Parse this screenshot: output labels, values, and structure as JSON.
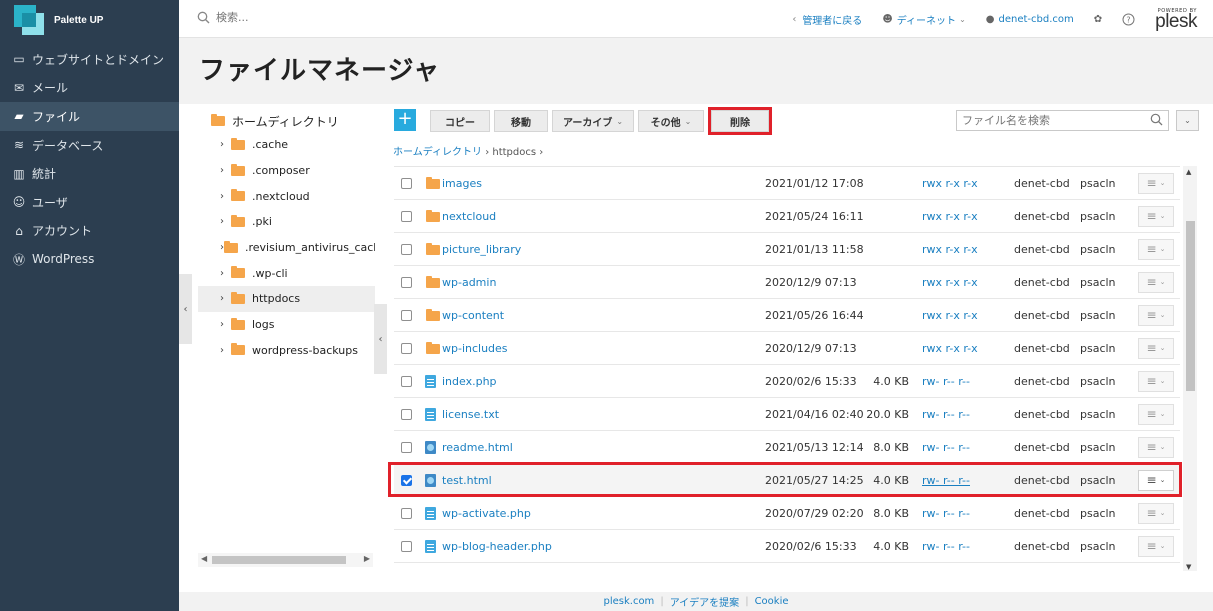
{
  "app": {
    "brand": "Palette UP"
  },
  "nav": {
    "items": [
      {
        "label": "ウェブサイトとドメイン",
        "icon": "monitor-icon"
      },
      {
        "label": "メール",
        "icon": "mail-icon"
      },
      {
        "label": "ファイル",
        "icon": "folder-icon",
        "active": true
      },
      {
        "label": "データベース",
        "icon": "database-icon"
      },
      {
        "label": "統計",
        "icon": "stats-icon"
      },
      {
        "label": "ユーザ",
        "icon": "user-icon"
      },
      {
        "label": "アカウント",
        "icon": "account-icon"
      },
      {
        "label": "WordPress",
        "icon": "wordpress-icon"
      }
    ]
  },
  "topbar": {
    "search_placeholder": "検索...",
    "back_admin": "管理者に戻る",
    "user": "ディーネット",
    "domain": "denet-cbd.com",
    "powered_by": "POWERED BY",
    "plesk": "plesk"
  },
  "page": {
    "title": "ファイルマネージャ"
  },
  "tree": {
    "root": "ホームディレクトリ",
    "items": [
      {
        "label": ".cache"
      },
      {
        "label": ".composer"
      },
      {
        "label": ".nextcloud"
      },
      {
        "label": ".pki"
      },
      {
        "label": ".revisium_antivirus_cache"
      },
      {
        "label": ".wp-cli"
      },
      {
        "label": "httpdocs",
        "selected": true
      },
      {
        "label": "logs"
      },
      {
        "label": "wordpress-backups"
      }
    ]
  },
  "toolbar": {
    "add": "+",
    "copy": "コピー",
    "move": "移動",
    "archive": "アーカイブ",
    "other": "その他",
    "delete": "削除",
    "search_placeholder": "ファイル名を検索"
  },
  "breadcrumb": {
    "root": "ホームディレクトリ",
    "current": "httpdocs"
  },
  "files": [
    {
      "name": "images",
      "type": "folder",
      "date": "2021/01/12 17:08",
      "size": "",
      "perm": "rwx r-x r-x",
      "user": "denet-cbd",
      "group": "psacln",
      "checked": false
    },
    {
      "name": "nextcloud",
      "type": "folder",
      "date": "2021/05/24 16:11",
      "size": "",
      "perm": "rwx r-x r-x",
      "user": "denet-cbd",
      "group": "psacln",
      "checked": false
    },
    {
      "name": "picture_library",
      "type": "folder",
      "date": "2021/01/13 11:58",
      "size": "",
      "perm": "rwx r-x r-x",
      "user": "denet-cbd",
      "group": "psacln",
      "checked": false
    },
    {
      "name": "wp-admin",
      "type": "folder",
      "date": "2020/12/9 07:13",
      "size": "",
      "perm": "rwx r-x r-x",
      "user": "denet-cbd",
      "group": "psacln",
      "checked": false
    },
    {
      "name": "wp-content",
      "type": "folder",
      "date": "2021/05/26 16:44",
      "size": "",
      "perm": "rwx r-x r-x",
      "user": "denet-cbd",
      "group": "psacln",
      "checked": false
    },
    {
      "name": "wp-includes",
      "type": "folder",
      "date": "2020/12/9 07:13",
      "size": "",
      "perm": "rwx r-x r-x",
      "user": "denet-cbd",
      "group": "psacln",
      "checked": false
    },
    {
      "name": "index.php",
      "type": "doc",
      "date": "2020/02/6 15:33",
      "size": "4.0 KB",
      "perm": "rw- r-- r--",
      "user": "denet-cbd",
      "group": "psacln",
      "checked": false
    },
    {
      "name": "license.txt",
      "type": "doc",
      "date": "2021/04/16 02:40",
      "size": "20.0 KB",
      "perm": "rw- r-- r--",
      "user": "denet-cbd",
      "group": "psacln",
      "checked": false
    },
    {
      "name": "readme.html",
      "type": "html",
      "date": "2021/05/13 12:14",
      "size": "8.0 KB",
      "perm": "rw- r-- r--",
      "user": "denet-cbd",
      "group": "psacln",
      "checked": false
    },
    {
      "name": "test.html",
      "type": "html",
      "date": "2021/05/27 14:25",
      "size": "4.0 KB",
      "perm": "rw- r-- r--",
      "user": "denet-cbd",
      "group": "psacln",
      "checked": true
    },
    {
      "name": "wp-activate.php",
      "type": "doc",
      "date": "2020/07/29 02:20",
      "size": "8.0 KB",
      "perm": "rw- r-- r--",
      "user": "denet-cbd",
      "group": "psacln",
      "checked": false
    },
    {
      "name": "wp-blog-header.php",
      "type": "doc",
      "date": "2020/02/6 15:33",
      "size": "4.0 KB",
      "perm": "rw- r-- r--",
      "user": "denet-cbd",
      "group": "psacln",
      "checked": false
    }
  ],
  "footer": {
    "links": [
      "plesk.com",
      "アイデアを提案",
      "Cookie"
    ]
  },
  "colors": {
    "nav_bg": "#2c3e50",
    "accent": "#28aade",
    "link": "#1a7fc1",
    "highlight": "#e0212a"
  }
}
